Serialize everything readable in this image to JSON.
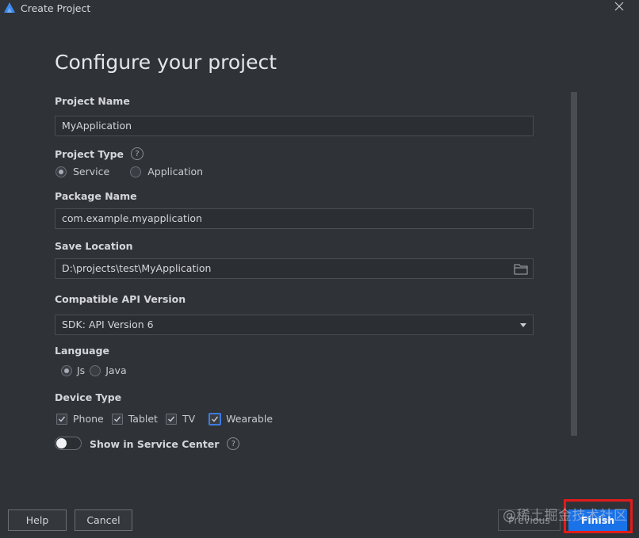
{
  "window": {
    "title": "Create Project"
  },
  "heading": "Configure your project",
  "project_name": {
    "label": "Project Name",
    "value": "MyApplication"
  },
  "project_type": {
    "label": "Project Type",
    "help": "?",
    "options": [
      {
        "label": "Service",
        "selected": true
      },
      {
        "label": "Application",
        "selected": false
      }
    ]
  },
  "package_name": {
    "label": "Package Name",
    "value": "com.example.myapplication"
  },
  "save_location": {
    "label": "Save Location",
    "value": "D:\\projects\\test\\MyApplication"
  },
  "api_version": {
    "label": "Compatible API Version",
    "selected": "SDK: API Version 6"
  },
  "language": {
    "label": "Language",
    "options": [
      {
        "label": "Js",
        "selected": true
      },
      {
        "label": "Java",
        "selected": false
      }
    ]
  },
  "device_type": {
    "label": "Device Type",
    "options": [
      {
        "label": "Phone",
        "checked": true
      },
      {
        "label": "Tablet",
        "checked": true
      },
      {
        "label": "TV",
        "checked": true
      },
      {
        "label": "Wearable",
        "checked": true
      }
    ]
  },
  "service_center": {
    "label": "Show in Service Center",
    "help": "?",
    "enabled": false
  },
  "buttons": {
    "help": "Help",
    "cancel": "Cancel",
    "previous": "Previous",
    "finish": "Finish"
  },
  "watermark": "@稀土掘金技术社区",
  "colors": {
    "accent": "#1a72e8",
    "highlight": "#e21b1b",
    "background": "#2f3237"
  }
}
